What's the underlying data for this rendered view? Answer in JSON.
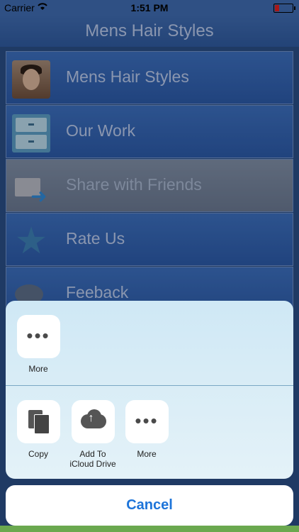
{
  "status_bar": {
    "carrier": "Carrier",
    "time": "1:51 PM"
  },
  "navbar": {
    "title": "Mens Hair Styles"
  },
  "menu": {
    "items": [
      {
        "label": "Mens Hair Styles",
        "icon": "hair-model-avatar-icon"
      },
      {
        "label": "Our Work",
        "icon": "drawer-icon"
      },
      {
        "label": "Share with Friends",
        "icon": "share-envelope-icon"
      },
      {
        "label": "Rate Us",
        "icon": "star-icon"
      },
      {
        "label": "Feeback",
        "icon": "feedback-bubble-icon"
      }
    ]
  },
  "share_sheet": {
    "row1": [
      {
        "label": "More",
        "icon": "more-dots-icon"
      }
    ],
    "row2": [
      {
        "label": "Copy",
        "icon": "copy-docs-icon"
      },
      {
        "label": "Add To\niCloud Drive",
        "icon": "icloud-upload-icon"
      },
      {
        "label": "More",
        "icon": "more-dots-icon"
      }
    ],
    "cancel_label": "Cancel"
  },
  "colors": {
    "accent": "#1d74d9",
    "nav": "#3f6bb0",
    "sheet": "#d8edf6"
  }
}
